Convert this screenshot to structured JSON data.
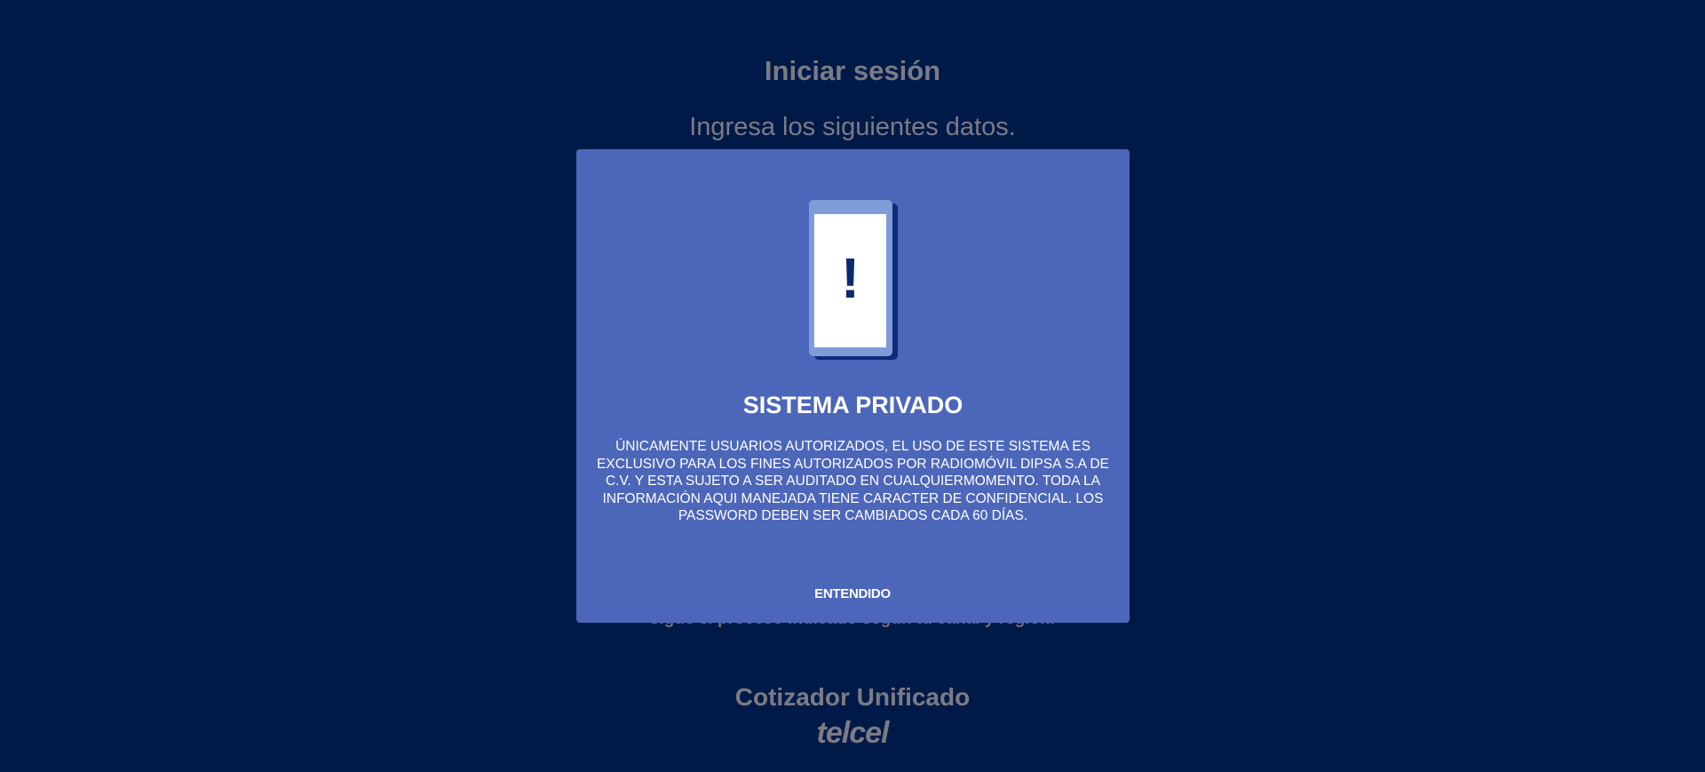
{
  "page": {
    "title": "Iniciar sesión",
    "subtitle": "Ingresa los siguientes datos.",
    "hint": "sigue el proceso indicado según tu canal y región.",
    "app_name": "Cotizador Unificado",
    "brand": "telcel"
  },
  "modal": {
    "icon": "phone-alert-icon",
    "icon_mark": "!",
    "title": "SISTEMA PRIVADO",
    "body": "ÚNICAMENTE USUARIOS AUTORIZADOS, EL USO DE ESTE SISTEMA ES EXCLUSIVO PARA LOS FINES AUTORIZADOS POR RADIOMÓVIL DIPSA S.A DE C.V. Y ESTA SUJETO A SER AUDITADO EN CUALQUIERMOMENTO. TODA LA INFORMACIÓN AQUI MANEJADA TIENE CARACTER DE CONFIDENCIAL. LOS PASSWORD DEBEN SER CAMBIADOS CADA 60 DÍAS.",
    "button_label": "ENTENDIDO"
  },
  "colors": {
    "background": "#001a48",
    "modal_background": "#4c66b9",
    "modal_text": "#ffffff"
  }
}
